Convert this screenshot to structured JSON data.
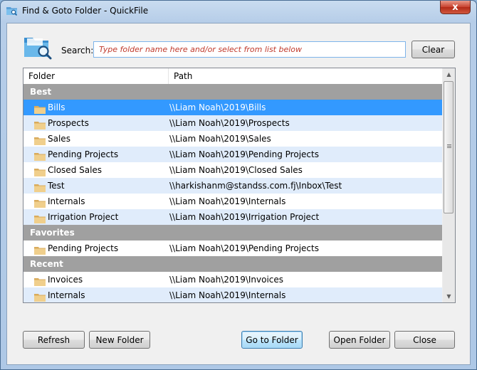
{
  "window": {
    "title": "Find & Goto Folder - QuickFile",
    "close_glyph": "x"
  },
  "search": {
    "label": "Search:",
    "placeholder": "Type folder name here and/or select from list below",
    "value": "",
    "clear_label": "Clear"
  },
  "list": {
    "columns": {
      "folder": "Folder",
      "path": "Path"
    },
    "groups": [
      {
        "name": "Best",
        "items": [
          {
            "name": "Bills",
            "path": "\\\\Liam Noah\\2019\\Bills",
            "selected": true
          },
          {
            "name": "Prospects",
            "path": "\\\\Liam Noah\\2019\\Prospects"
          },
          {
            "name": "Sales",
            "path": "\\\\Liam Noah\\2019\\Sales"
          },
          {
            "name": "Pending Projects",
            "path": "\\\\Liam Noah\\2019\\Pending Projects"
          },
          {
            "name": "Closed Sales",
            "path": "\\\\Liam Noah\\2019\\Closed Sales"
          },
          {
            "name": "Test",
            "path": "\\\\harkishanm@standss.com.fj\\Inbox\\Test"
          },
          {
            "name": "Internals",
            "path": "\\\\Liam Noah\\2019\\Internals"
          },
          {
            "name": "Irrigation Project",
            "path": "\\\\Liam Noah\\2019\\Irrigation Project"
          }
        ]
      },
      {
        "name": "Favorites",
        "items": [
          {
            "name": "Pending Projects",
            "path": "\\\\Liam Noah\\2019\\Pending Projects"
          }
        ]
      },
      {
        "name": "Recent",
        "items": [
          {
            "name": "Invoices",
            "path": "\\\\Liam Noah\\2019\\Invoices"
          },
          {
            "name": "Internals",
            "path": "\\\\Liam Noah\\2019\\Internals"
          }
        ]
      }
    ]
  },
  "buttons": {
    "refresh": "Refresh",
    "new_folder": "New Folder",
    "go_to_folder": "Go to Folder",
    "open_folder": "Open Folder",
    "close": "Close"
  },
  "colors": {
    "selection": "#3399ff",
    "alt_row": "#e0ecfb",
    "group_header": "#a0a0a0",
    "placeholder_text": "#c0392b",
    "folder_icon": "#e8c27a"
  },
  "icons": {
    "app": "folder-search-icon",
    "search": "folder-magnifier-icon",
    "folder": "folder-icon",
    "scroll_up": "arrow-up-icon",
    "scroll_down": "arrow-down-icon"
  }
}
